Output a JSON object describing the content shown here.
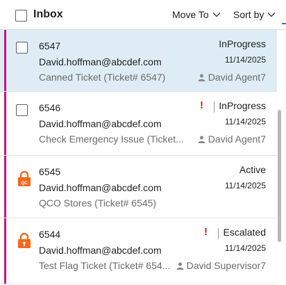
{
  "header": {
    "title": "Inbox",
    "move_to_label": "Move To",
    "sort_by_label": "Sort by"
  },
  "colors": {
    "selected_row": "#deedf5",
    "priority_bar": "#d10f83",
    "lock_icon": "#f26b1d",
    "flag": "#e0162b"
  },
  "tickets": [
    {
      "id": "6547",
      "email": "David.hoffman@abcdef.com",
      "subject": "Canned Ticket (Ticket# 6547)",
      "status": "InProgress",
      "date": "11/14/2025",
      "agent": "David Agent7",
      "selected": true,
      "locked": false,
      "flagged": false,
      "lock_badge": ""
    },
    {
      "id": "6546",
      "email": "David.hoffman@abcdef.com",
      "subject": "Check Emergency Issue (Ticket...",
      "status": "InProgress",
      "date": "11/14/2025",
      "agent": "David Agent7",
      "selected": false,
      "locked": false,
      "flagged": true,
      "lock_badge": ""
    },
    {
      "id": "6545",
      "email": "David.hoffman@abcdef.com",
      "subject": "QCO Stores (Ticket# 6545)",
      "status": "Active",
      "date": "11/14/2025",
      "agent": "",
      "selected": false,
      "locked": true,
      "flagged": false,
      "lock_badge": "QC"
    },
    {
      "id": "6544",
      "email": "David.hoffman@abcdef.com",
      "subject": "Test Flag Ticket (Ticket# 654...",
      "status": "Escalated",
      "date": "11/14/2025",
      "agent": "David Supervisor7",
      "selected": false,
      "locked": true,
      "flagged": true,
      "lock_badge": ""
    }
  ],
  "flag_symbol": "!"
}
